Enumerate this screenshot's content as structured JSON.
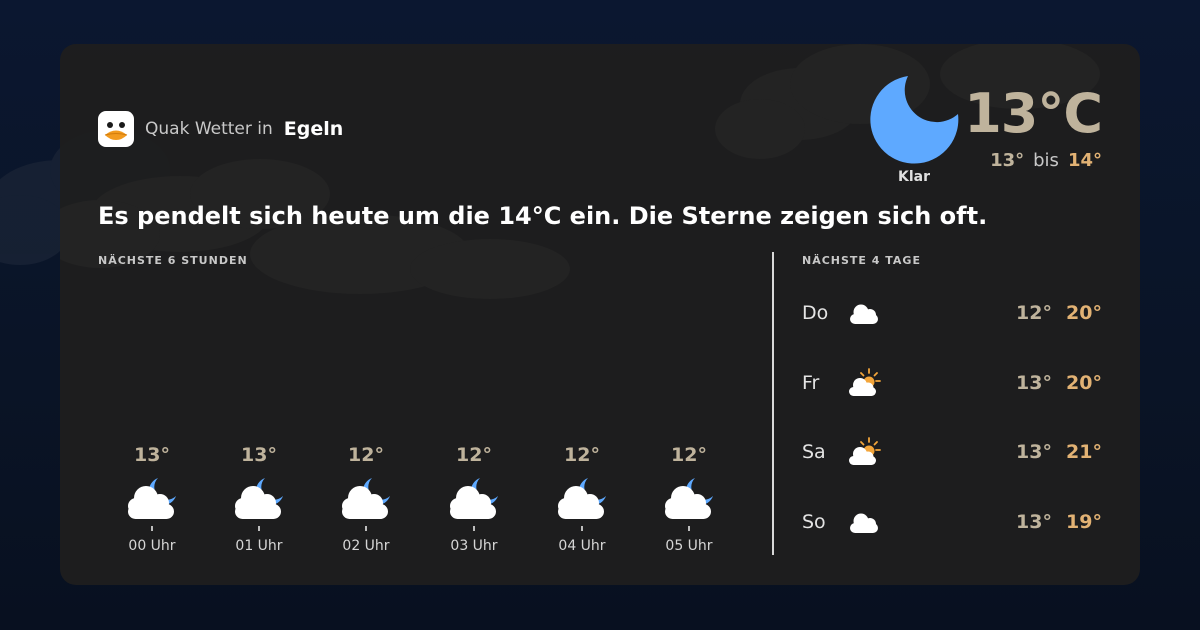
{
  "brand": {
    "prefix": "Quak Wetter in",
    "location": "Egeln"
  },
  "current": {
    "temperature": "13°C",
    "condition": "Klar",
    "min": "13°",
    "max": "14°",
    "range_separator": "bis",
    "icon": "moon-icon"
  },
  "summary": "Es pendelt sich heute um die 14°C ein. Die Sterne zeigen sich oft.",
  "hourly": {
    "label": "NÄCHSTE 6 STUNDEN",
    "items": [
      {
        "time": "00 Uhr",
        "temp": "13°",
        "icon": "cloud-moon-icon"
      },
      {
        "time": "01 Uhr",
        "temp": "13°",
        "icon": "cloud-moon-icon"
      },
      {
        "time": "02 Uhr",
        "temp": "12°",
        "icon": "cloud-moon-icon"
      },
      {
        "time": "03 Uhr",
        "temp": "12°",
        "icon": "cloud-moon-icon"
      },
      {
        "time": "04 Uhr",
        "temp": "12°",
        "icon": "cloud-moon-icon"
      },
      {
        "time": "05 Uhr",
        "temp": "12°",
        "icon": "cloud-moon-icon"
      }
    ]
  },
  "daily": {
    "label": "NÄCHSTE 4 TAGE",
    "items": [
      {
        "day": "Do",
        "min": "12°",
        "max": "20°",
        "icon": "cloud-icon"
      },
      {
        "day": "Fr",
        "min": "13°",
        "max": "20°",
        "icon": "cloud-sun-icon"
      },
      {
        "day": "Sa",
        "min": "13°",
        "max": "21°",
        "icon": "cloud-sun-icon"
      },
      {
        "day": "So",
        "min": "13°",
        "max": "19°",
        "icon": "cloud-icon"
      }
    ]
  },
  "colors": {
    "temperature": "#bfb39c",
    "max_temperature": "#e2b274",
    "moon": "#5ea9ff",
    "sun": "#f3a53a",
    "background": "#0b1730",
    "card": "#1e1e1e"
  }
}
